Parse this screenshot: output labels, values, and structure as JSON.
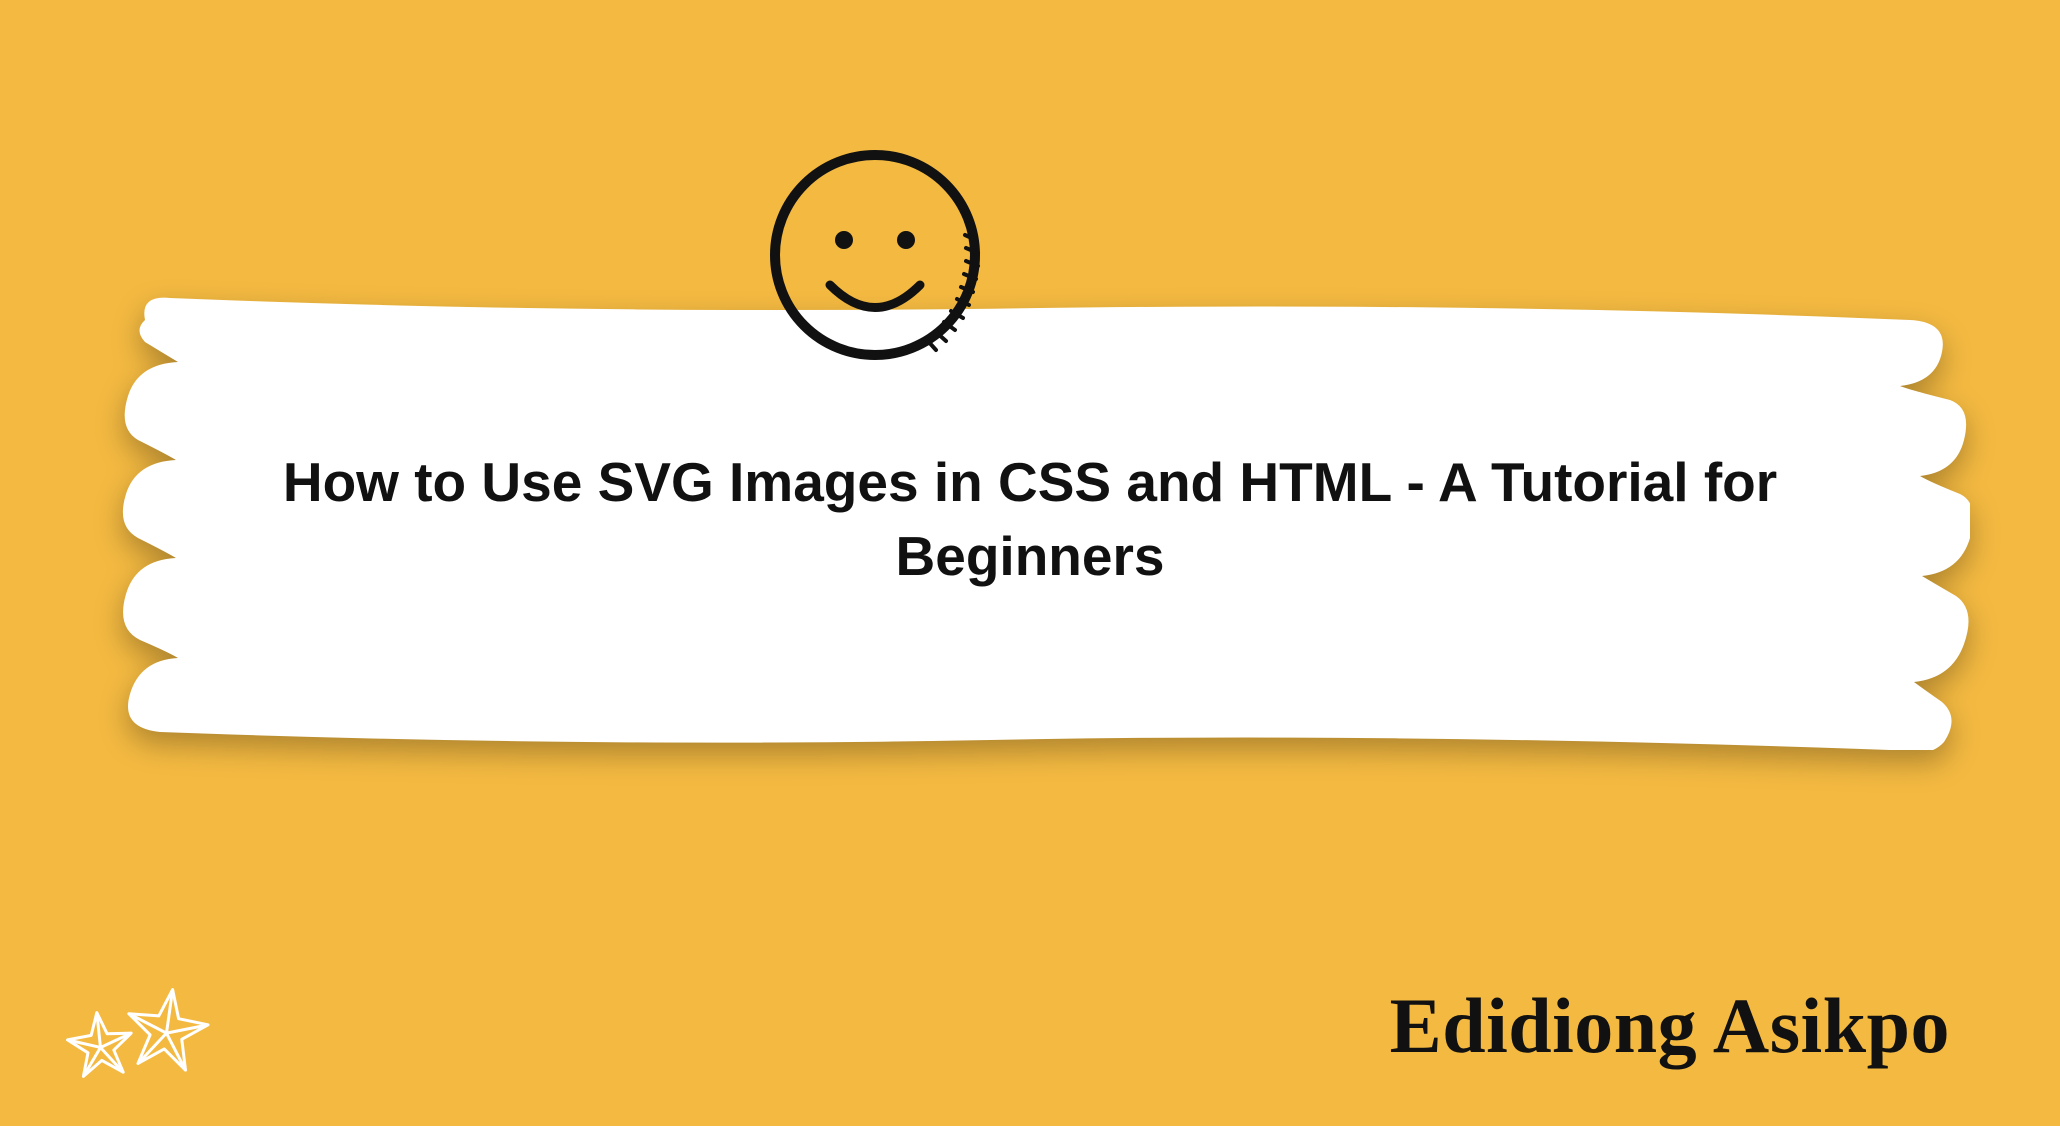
{
  "title": "How to Use SVG Images in CSS and HTML - A Tutorial for Beginners",
  "author": "Edidiong Asikpo",
  "colors": {
    "background": "#f3b941",
    "brush": "#ffffff",
    "text": "#111111",
    "starStroke": "#ffffff"
  }
}
